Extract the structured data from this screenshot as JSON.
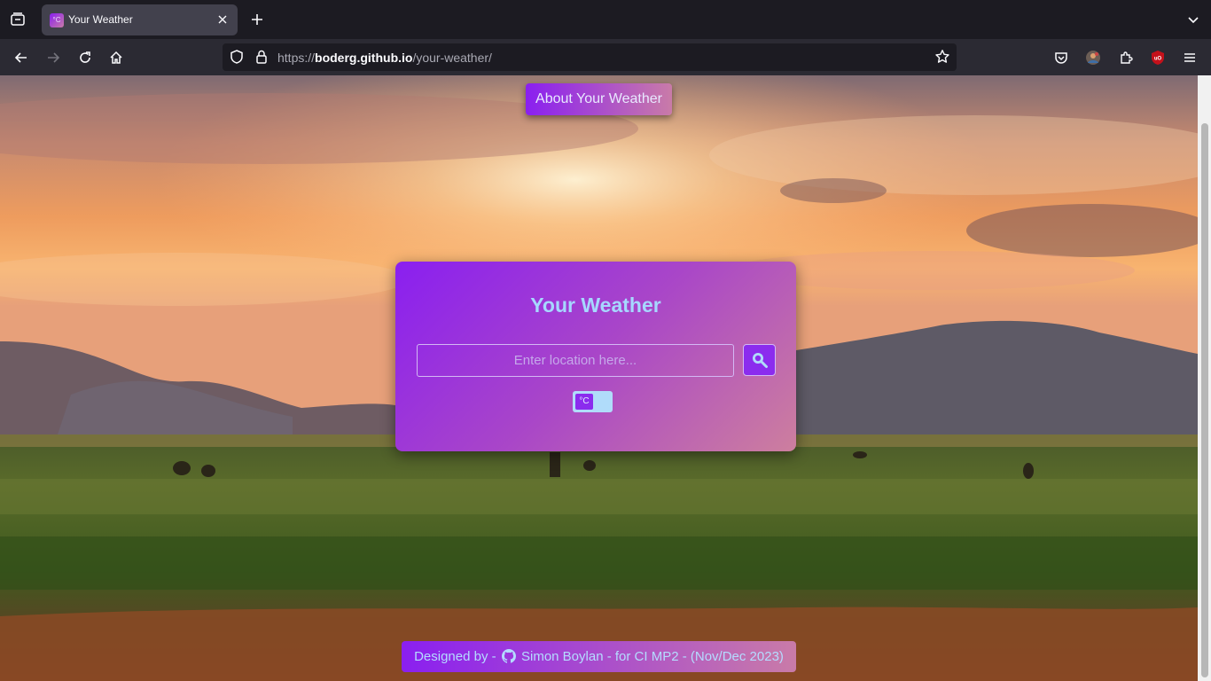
{
  "browser": {
    "tab_title": "Your Weather",
    "favicon_text": "°C",
    "url_prefix": "https://",
    "url_host": "boderg.github.io",
    "url_path": "/your-weather/"
  },
  "page": {
    "about_button": "About Your Weather",
    "card_title": "Your Weather",
    "search_placeholder": "Enter location here...",
    "unit_toggle": "°C",
    "footer_prefix": "Designed by -",
    "footer_author": "Simon Boylan - for CI MP2 - (Nov/Dec 2023)"
  },
  "colors": {
    "accent_purple": "#8a1ff0",
    "accent_pink": "#c97ba8",
    "title_blue": "#a6d8ff"
  },
  "icons": [
    "list-all-tabs-icon",
    "close-tab-icon",
    "new-tab-icon",
    "tab-overflow-icon",
    "back-icon",
    "forward-icon",
    "reload-icon",
    "home-icon",
    "tracking-shield-icon",
    "lock-icon",
    "bookmark-star-icon",
    "pocket-icon",
    "profile-avatar-icon",
    "extensions-icon",
    "ublock-icon",
    "menu-icon",
    "search-magnifier-icon",
    "github-icon"
  ]
}
